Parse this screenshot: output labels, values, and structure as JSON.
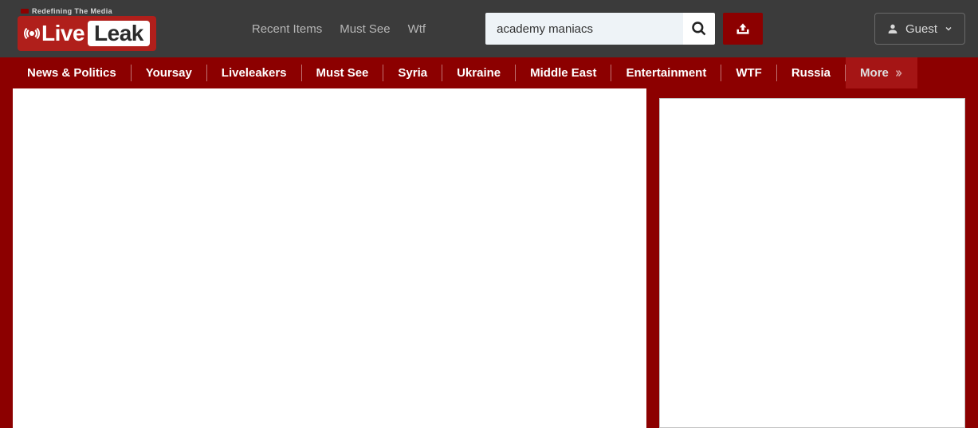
{
  "tagline": "Redefining The Media",
  "logo": {
    "part1": "Live",
    "part2": "Leak"
  },
  "top_links": [
    "Recent Items",
    "Must See",
    "Wtf"
  ],
  "search": {
    "value": "academy maniacs"
  },
  "guest_label": "Guest",
  "nav": [
    "News & Politics",
    "Yoursay",
    "Liveleakers",
    "Must See",
    "Syria",
    "Ukraine",
    "Middle East",
    "Entertainment",
    "WTF",
    "Russia"
  ],
  "nav_more": "More"
}
